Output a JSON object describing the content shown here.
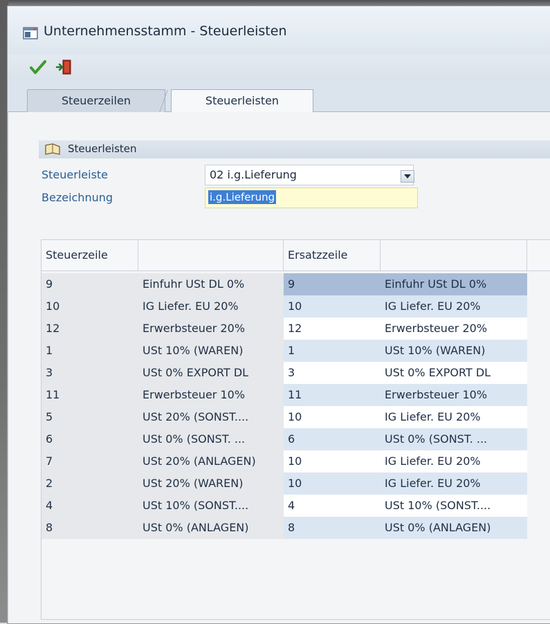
{
  "window": {
    "title": "Unternehmensstamm - Steuerleisten"
  },
  "tabs": [
    {
      "label": "Steuerzeilen"
    },
    {
      "label": "Steuerleisten"
    }
  ],
  "group": {
    "title": "Steuerleisten"
  },
  "fields": {
    "steuerleiste": {
      "label": "Steuerleiste",
      "value": "02  i.g.Lieferung"
    },
    "bezeichnung": {
      "label": "Bezeichnung",
      "value": "i.g.Lieferung"
    }
  },
  "grid": {
    "headers": [
      "Steuerzeile",
      "",
      "Ersatzzeile",
      ""
    ],
    "rows": [
      {
        "steuerzeile": "9",
        "steuer_bez": "Einfuhr USt DL 0%",
        "ersatzzeile": "9",
        "ersatz_bez": "Einfuhr USt DL 0%"
      },
      {
        "steuerzeile": "10",
        "steuer_bez": "IG Liefer. EU 20%",
        "ersatzzeile": "10",
        "ersatz_bez": "IG Liefer. EU 20%"
      },
      {
        "steuerzeile": "12",
        "steuer_bez": "Erwerbsteuer 20%",
        "ersatzzeile": "12",
        "ersatz_bez": "Erwerbsteuer 20%"
      },
      {
        "steuerzeile": "1",
        "steuer_bez": "USt 10% (WAREN)",
        "ersatzzeile": "1",
        "ersatz_bez": "USt 10% (WAREN)"
      },
      {
        "steuerzeile": "3",
        "steuer_bez": " USt 0%  EXPORT DL",
        "ersatzzeile": "3",
        "ersatz_bez": " USt 0%  EXPORT DL"
      },
      {
        "steuerzeile": "11",
        "steuer_bez": "Erwerbsteuer 10%",
        "ersatzzeile": "11",
        "ersatz_bez": "Erwerbsteuer 10%"
      },
      {
        "steuerzeile": "5",
        "steuer_bez": "USt 20% (SONST....",
        "ersatzzeile": "10",
        "ersatz_bez": "IG Liefer. EU 20%"
      },
      {
        "steuerzeile": "6",
        "steuer_bez": " USt 0%  (SONST. ...",
        "ersatzzeile": "6",
        "ersatz_bez": " USt 0%  (SONST. ..."
      },
      {
        "steuerzeile": "7",
        "steuer_bez": "USt 20% (ANLAGEN)",
        "ersatzzeile": "10",
        "ersatz_bez": "IG Liefer. EU 20%"
      },
      {
        "steuerzeile": "2",
        "steuer_bez": "USt 20% (WAREN)",
        "ersatzzeile": "10",
        "ersatz_bez": "IG Liefer. EU 20%"
      },
      {
        "steuerzeile": "4",
        "steuer_bez": "USt 10% (SONST....",
        "ersatzzeile": "4",
        "ersatz_bez": "USt 10% (SONST...."
      },
      {
        "steuerzeile": "8",
        "steuer_bez": " USt 0%  (ANLAGEN)",
        "ersatzzeile": "8",
        "ersatz_bez": " USt 0%  (ANLAGEN)"
      }
    ]
  },
  "icons": {
    "window": "window-icon",
    "save": "checkmark-icon",
    "exit": "exit-door-icon",
    "group": "book-icon",
    "dropdown": "chevron-down-icon"
  },
  "colors": {
    "selection": "#3d7fd6",
    "selected_row": "#a8bcd8",
    "alt_row": "#dbe6f3",
    "label_blue": "#2a5d95"
  }
}
